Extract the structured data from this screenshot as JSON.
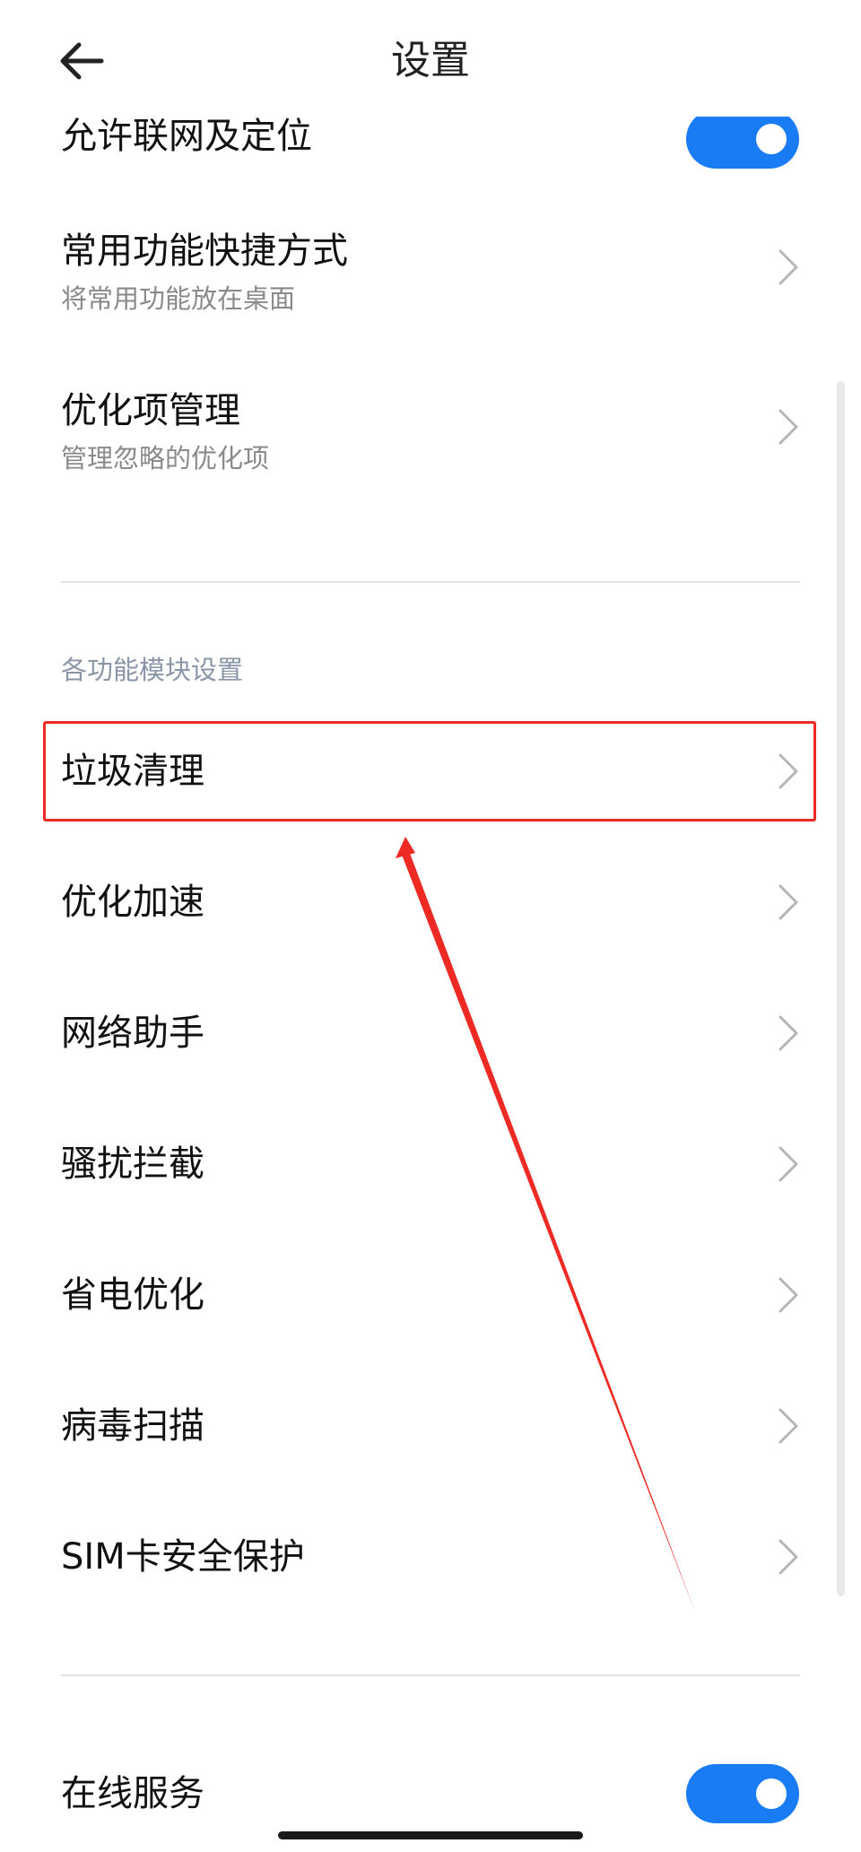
{
  "header": {
    "title": "设置"
  },
  "settings": {
    "network_location": {
      "title": "允许联网及定位",
      "enabled": true
    },
    "shortcut": {
      "title": "常用功能快捷方式",
      "subtitle": "将常用功能放在桌面"
    },
    "optimization": {
      "title": "优化项管理",
      "subtitle": "管理忽略的优化项"
    }
  },
  "modules": {
    "section_label": "各功能模块设置",
    "items": [
      {
        "label": "垃圾清理"
      },
      {
        "label": "优化加速"
      },
      {
        "label": "网络助手"
      },
      {
        "label": "骚扰拦截"
      },
      {
        "label": "省电优化"
      },
      {
        "label": "病毒扫描"
      },
      {
        "label": "SIM卡安全保护"
      }
    ]
  },
  "online_service": {
    "title": "在线服务",
    "enabled": true
  },
  "colors": {
    "accent": "#1a7cf5",
    "annotation": "#ee2a24"
  },
  "icons": {
    "back": "back-arrow-icon",
    "chevron": "chevron-right-icon"
  }
}
